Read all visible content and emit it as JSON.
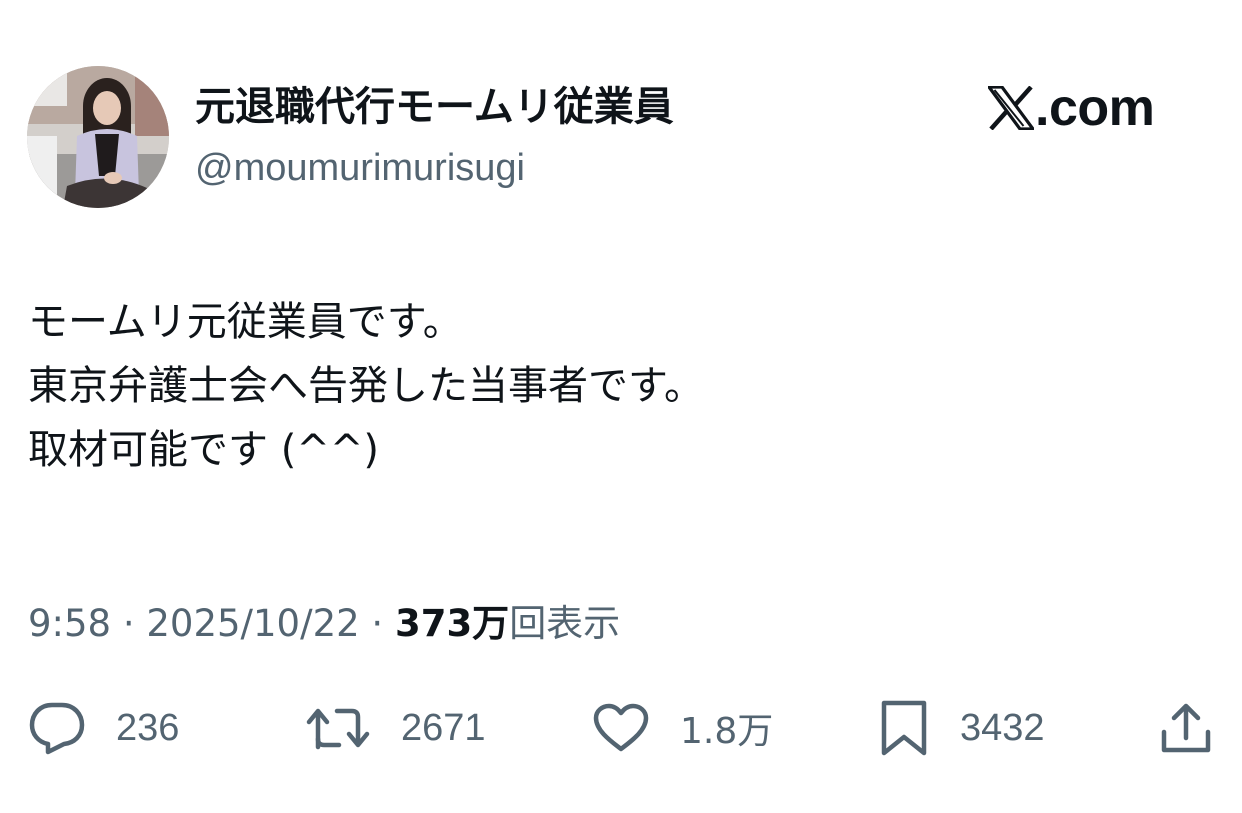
{
  "header": {
    "display_name": "元退職代行モームリ従業員",
    "handle": "@moumurimurisugi",
    "brand_domain": ".com"
  },
  "tweet": {
    "lines": [
      "モームリ元従業員です。",
      "東京弁護士会へ告発した当事者です。",
      "取材可能です (^^)"
    ]
  },
  "meta": {
    "time": "9:58",
    "separator": " · ",
    "date": "2025/10/22",
    "views_count": "373万",
    "views_label": "回表示"
  },
  "actions": {
    "replies": {
      "icon": "reply-icon",
      "count": "236"
    },
    "reposts": {
      "icon": "repost-icon",
      "count": "2671"
    },
    "likes": {
      "icon": "heart-icon",
      "count": "1.8万"
    },
    "bookmarks": {
      "icon": "bookmark-icon",
      "count": "3432"
    },
    "share": {
      "icon": "share-icon"
    }
  },
  "colors": {
    "text_primary": "#0f1419",
    "text_secondary": "#536471"
  }
}
